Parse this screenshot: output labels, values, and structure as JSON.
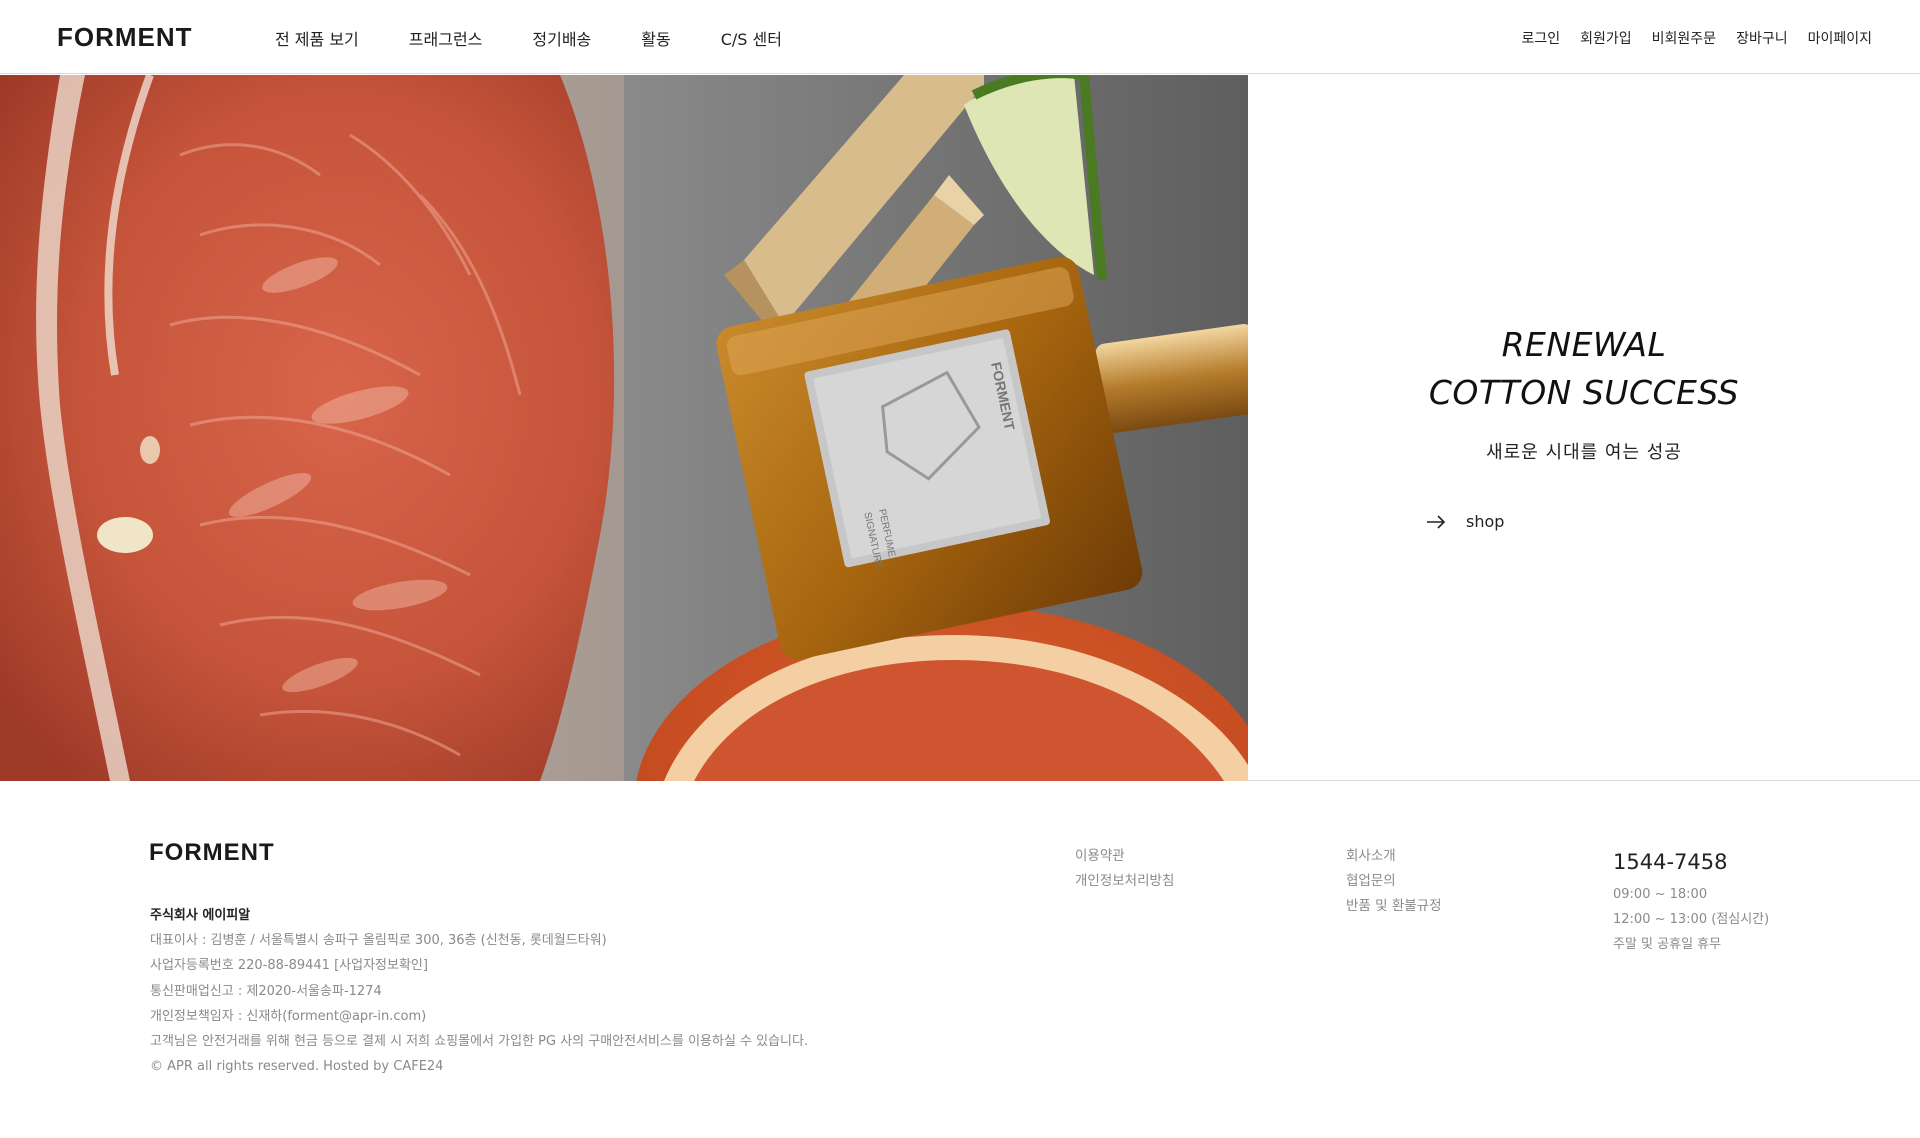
{
  "header": {
    "logo": "FORMENT",
    "nav": [
      "전 제품 보기",
      "프래그런스",
      "정기배송",
      "활동",
      "C/S 센터"
    ],
    "util": [
      "로그인",
      "회원가입",
      "비회원주문",
      "장바구니",
      "마이페이지"
    ]
  },
  "hero": {
    "title_line1": "RENEWAL",
    "title_line2": "COTTON SUCCESS",
    "subtitle": "새로운 시대를 여는 성공",
    "shop_label": "shop",
    "bottle_label_line1": "SIGNATURE",
    "bottle_label_line2": "PERFUME",
    "bottle_brand": "FORMENT"
  },
  "footer": {
    "logo": "FORMENT",
    "company": "주식회사 에이피알",
    "info": [
      "대표이사 : 김병훈 / 서울특별시 송파구 올림픽로 300, 36층 (신천동, 롯데월드타워)",
      "사업자등록번호 220-88-89441 [사업자정보확인]",
      "통신판매업신고 : 제2020-서울송파-1274",
      "개인정보책임자 : 신재하(forment@apr-in.com)",
      "고객님은 안전거래를 위해 현금 등으로 결제 시 저희 쇼핑몰에서 가입한 PG 사의 구매안전서비스를 이용하실 수 있습니다.",
      "© APR all rights reserved. Hosted by CAFE24"
    ],
    "links_col1": [
      "이용약관",
      "개인정보처리방침"
    ],
    "links_col2": [
      "회사소개",
      "협업문의",
      "반품 및 환불규정"
    ],
    "cs": {
      "tel": "1544-7458",
      "hours": [
        "09:00 ~ 18:00",
        "12:00 ~ 13:00 (점심시간)",
        "주말 및 공휴일 휴무"
      ]
    }
  },
  "colors": {
    "text": "#222222",
    "muted": "#8a8a8a",
    "border": "#dcdcdc",
    "grapefruit": "#c5543a",
    "amber": "#a8660f"
  }
}
